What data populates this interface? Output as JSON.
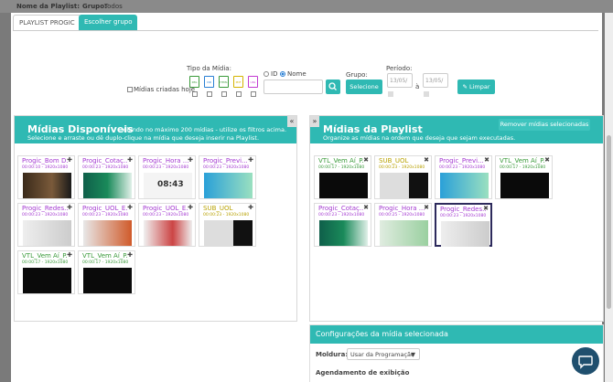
{
  "header": {
    "name_label": "Nome da Playlist:",
    "group_label": "Grupo:",
    "group_value": "Todos"
  },
  "tabs": [
    {
      "label": "PLAYLIST PROGIC"
    },
    {
      "label": "Escolher grupo"
    }
  ],
  "filters": {
    "media_type_label": "Tipo da Mídia:",
    "file_types": [
      "IMG",
      "VID",
      "HTML",
      "PDF",
      "URL"
    ],
    "today_label": "Mídias criadas hoje",
    "id_label": "ID",
    "name_label": "Nome",
    "group_label": "Grupo:",
    "select_label": "Selecione",
    "period_label": "Período:",
    "date_from": "13/05/",
    "date_sep": "à",
    "date_to": "13/05/",
    "clear_label": "Limpar",
    "search_icon": "search-icon",
    "clear_icon": "eraser-icon"
  },
  "available": {
    "title": "Mídias Disponíveis",
    "subtitle_1": "Exibindo no máximo 200 mídias - utilize os filtros acima.",
    "subtitle_2": "Selecione e arraste ou dê duplo-clique na mídia que deseja inserir na Playlist.",
    "collapse": "«",
    "cards": [
      {
        "title": "Progic_Bom D...",
        "meta": "00:00:10 - 1920x1080",
        "color": "#a43ad1"
      },
      {
        "title": "Progic_Cotaç...",
        "meta": "00:00:23 - 1920x1080",
        "color": "#a43ad1"
      },
      {
        "title": "Progic_Hora ...",
        "meta": "00:00:23 - 1920x1080",
        "color": "#a43ad1",
        "clock": "08:43"
      },
      {
        "title": "Progic_Previ...",
        "meta": "00:00:23 - 1920x1080",
        "color": "#a43ad1"
      },
      {
        "title": "Progic_Redes...",
        "meta": "00:00:23 - 1920x1080",
        "color": "#a43ad1"
      },
      {
        "title": "Progic_UOL_E...",
        "meta": "00:00:23 - 1920x1080",
        "color": "#a43ad1"
      },
      {
        "title": "Progic_UOL_E...",
        "meta": "00:00:23 - 1920x1080",
        "color": "#a43ad1"
      },
      {
        "title": "SUB_UOL",
        "meta": "00:00:23 - 1920x1080",
        "color": "#b8a100",
        "meta_top": "00:00:23"
      },
      {
        "title": "VTL_Vem Aí_P...",
        "meta": "00:00:17 - 1920x1080",
        "color": "#3a9a3a"
      },
      {
        "title": "VTL_Vem Aí_P...",
        "meta": "00:00:17 - 1920x1080",
        "color": "#3a9a3a"
      }
    ]
  },
  "playlist": {
    "title": "Mídias da Playlist",
    "subtitle": "Organize as mídias na ordem que deseja que sejam executadas.",
    "remove_label": "Remover mídias selecionadas",
    "expand": "»",
    "cards": [
      {
        "title": "VTL_Vem Aí_P...",
        "meta": "00:00:17 - 1920x1080",
        "color": "#3a9a3a"
      },
      {
        "title": "SUB_UOL",
        "meta": "00:00:23 - 1920x1080",
        "color": "#b8a100",
        "meta_top": "00:00:23"
      },
      {
        "title": "Progic_Previ...",
        "meta": "00:00:23 - 1920x1080",
        "color": "#a43ad1"
      },
      {
        "title": "VTL_Vem Aí_P...",
        "meta": "00:00:17 - 1920x1080",
        "color": "#3a9a3a"
      },
      {
        "title": "Progic_Cotaç...",
        "meta": "00:00:23 - 1920x1080",
        "color": "#a43ad1"
      },
      {
        "title": "Progic_Hora ...",
        "meta": "00:00:25 - 1920x1080",
        "color": "#a43ad1"
      },
      {
        "title": "Progic_Redes...",
        "meta": "00:00:23 - 1920x1080",
        "color": "#a43ad1",
        "selected": true
      }
    ]
  },
  "config": {
    "title": "Configurações da mídia selecionada",
    "frame_label": "Moldura:",
    "frame_value": "Usar da Programação",
    "schedule_label": "Agendamento de exibição"
  },
  "colors": {
    "accent": "#2fb9b3",
    "progic": "#a43ad1",
    "vtl": "#3a9a3a",
    "sub": "#b8a100"
  }
}
